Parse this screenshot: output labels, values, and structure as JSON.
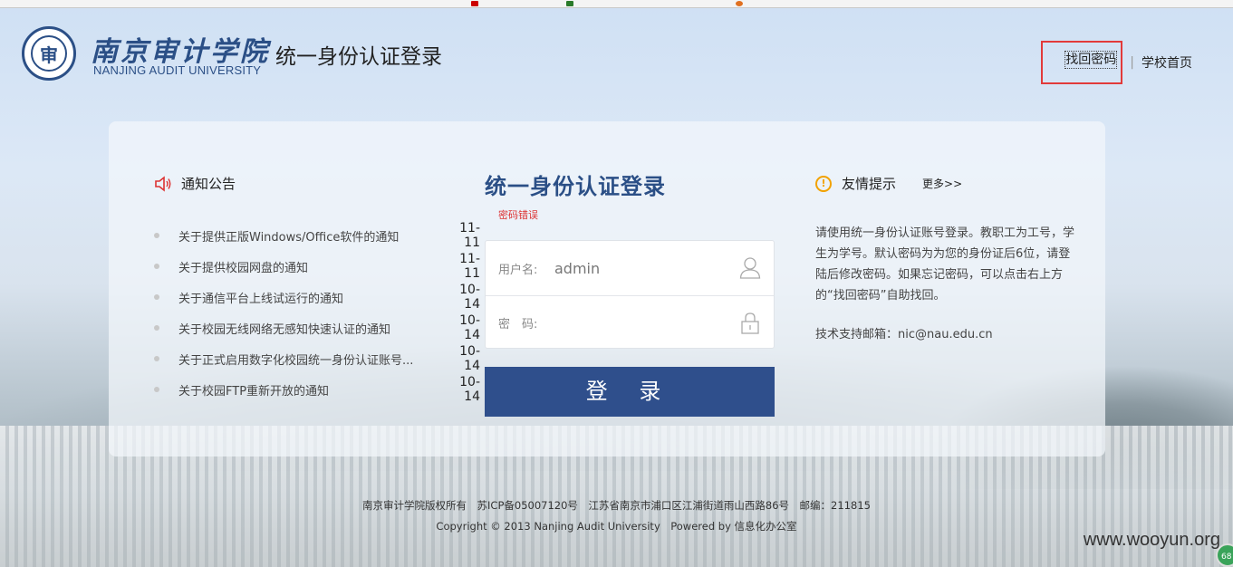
{
  "header": {
    "school_name_cn": "南京审计学院",
    "school_name_en": "NANJING AUDIT UNIVERSITY",
    "logo_seal_char": "审",
    "title": "统一身份认证登录",
    "forgot_password": "找回密码",
    "separator": "|",
    "home_link": "学校首页"
  },
  "notices": {
    "title": "通知公告",
    "items": [
      {
        "text": "关于提供正版Windows/Office软件的通知",
        "date": "11-11"
      },
      {
        "text": "关于提供校园网盘的通知",
        "date": "11-11"
      },
      {
        "text": "关于通信平台上线试运行的通知",
        "date": "10-14"
      },
      {
        "text": "关于校园无线网络无感知快速认证的通知",
        "date": "10-14"
      },
      {
        "text": "关于正式启用数字化校园统一身份认证账号...",
        "date": "10-14"
      },
      {
        "text": "关于校园FTP重新开放的通知",
        "date": "10-14"
      }
    ]
  },
  "login": {
    "title": "统一身份认证登录",
    "error": "密码错误",
    "username_label": "用户名:",
    "username_value": "admin",
    "password_label": "密　码:",
    "password_value": "",
    "submit_label": "登 录"
  },
  "tips": {
    "title": "友情提示",
    "more": "更多>>",
    "body": "请使用统一身份认证账号登录。教职工为工号，学生为学号。默认密码为为您的身份证后6位，请登陆后修改密码。如果忘记密码，可以点击右上方的“找回密码”自助找回。",
    "contact": "技术支持邮箱：nic@nau.edu.cn"
  },
  "footer": {
    "line1": "南京审计学院版权所有　苏ICP备05007120号　江苏省南京市浦口区江浦街道雨山西路86号　邮编：211815",
    "line2": "Copyright © 2013 Nanjing Audit University　Powered by 信息化办公室"
  },
  "watermark": "www.wooyun.org",
  "corner_badge": "68",
  "colors": {
    "brand_blue": "#2f4f8c",
    "error_red": "#dd3333",
    "highlight_box": "#e23a3a",
    "warning_orange": "#f2a200"
  }
}
